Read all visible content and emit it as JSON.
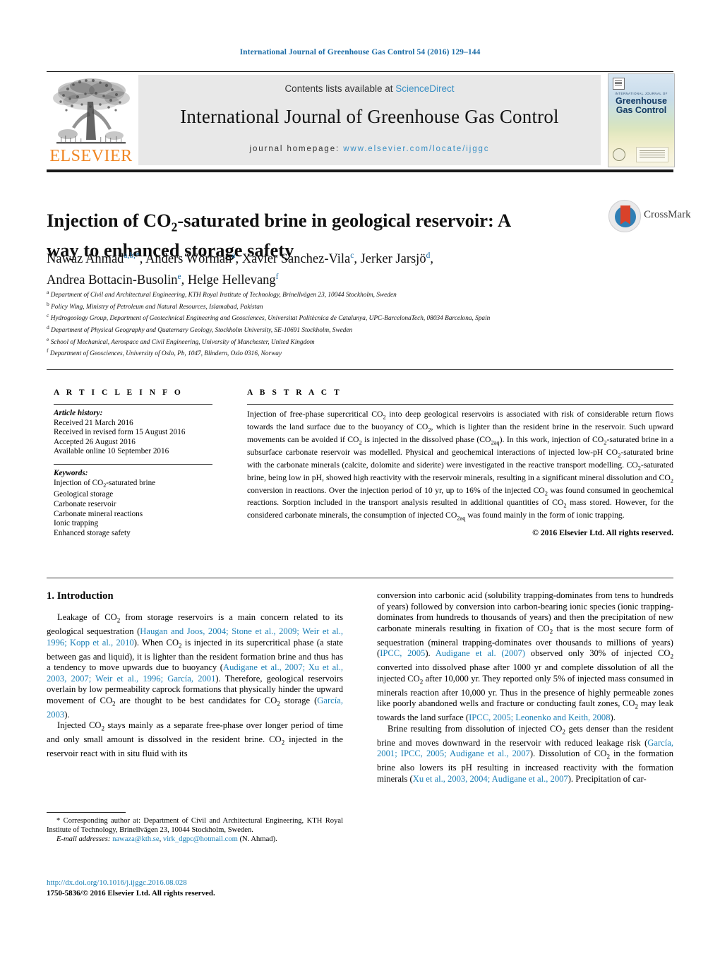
{
  "running_head": "International Journal of Greenhouse Gas Control 54 (2016) 129–144",
  "masthead": {
    "contents_prefix": "Contents lists available at ",
    "sciencedirect": "ScienceDirect",
    "journal_title": "International Journal of Greenhouse Gas Control",
    "homepage_label": "journal homepage:",
    "homepage_url": "www.elsevier.com/locate/ijggc",
    "publisher_logo_text": "ELSEVIER",
    "publisher_logo_color": "#f08522",
    "link_color": "#3a8fc4",
    "cover": {
      "kicker": "INTERNATIONAL JOURNAL OF",
      "name_line1": "Greenhouse",
      "name_line2": "Gas Control"
    }
  },
  "crossmark": {
    "label": "CrossMark"
  },
  "article": {
    "title_part1": "Injection of CO",
    "title_sub": "2",
    "title_part2": "-saturated brine in geological reservoir: A way to enhanced storage safety",
    "authors": [
      {
        "name": "Nawaz Ahmad",
        "marks": "a,b,*"
      },
      {
        "name": "Anders Wörman",
        "marks": "a"
      },
      {
        "name": "Xavier Sanchez-Vila",
        "marks": "c"
      },
      {
        "name": "Jerker Jarsjö",
        "marks": "d"
      },
      {
        "name": "Andrea Bottacin-Busolin",
        "marks": "e"
      },
      {
        "name": "Helge Hellevang",
        "marks": "f"
      }
    ],
    "affiliations": [
      {
        "mark": "a",
        "text": "Department of Civil and Architectural Engineering, KTH Royal Institute of Technology, Brinellvägen 23, 10044 Stockholm, Sweden"
      },
      {
        "mark": "b",
        "text": "Policy Wing, Ministry of Petroleum and Natural Resources, Islamabad, Pakistan"
      },
      {
        "mark": "c",
        "text": "Hydrogeology Group, Department of Geotechnical Engineering and Geosciences, Universitat Politècnica de Catalunya, UPC-BarcelonaTech, 08034 Barcelona, Spain"
      },
      {
        "mark": "d",
        "text": "Department of Physical Geography and Quaternary Geology, Stockholm University, SE-10691 Stockholm, Sweden"
      },
      {
        "mark": "e",
        "text": "School of Mechanical, Aerospace and Civil Engineering, University of Manchester, United Kingdom"
      },
      {
        "mark": "f",
        "text": "Department of Geosciences, University of Oslo, Pb, 1047, Blindern, Oslo 0316, Norway"
      }
    ]
  },
  "article_info": {
    "heading": "A R T I C L E   I N F O",
    "history_label": "Article history:",
    "history": [
      "Received 21 March 2016",
      "Received in revised form 15 August 2016",
      "Accepted 26 August 2016",
      "Available online 10 September 2016"
    ],
    "keywords_label": "Keywords:",
    "keywords": [
      "Injection of CO2-saturated brine",
      "Geological storage",
      "Carbonate reservoir",
      "Carbonate mineral reactions",
      "Ionic trapping",
      "Enhanced storage safety"
    ]
  },
  "abstract": {
    "heading": "A B S T R A C T",
    "text": "Injection of free-phase supercritical CO2 into deep geological reservoirs is associated with risk of considerable return flows towards the land surface due to the buoyancy of CO2, which is lighter than the resident brine in the reservoir. Such upward movements can be avoided if CO2 is injected in the dissolved phase (CO2aq). In this work, injection of CO2-saturated brine in a subsurface carbonate reservoir was modelled. Physical and geochemical interactions of injected low-pH CO2-saturated brine with the carbonate minerals (calcite, dolomite and siderite) were investigated in the reactive transport modelling. CO2-saturated brine, being low in pH, showed high reactivity with the reservoir minerals, resulting in a significant mineral dissolution and CO2 conversion in reactions. Over the injection period of 10 yr, up to 16% of the injected CO2 was found consumed in geochemical reactions. Sorption included in the transport analysis resulted in additional quantities of CO2 mass stored. However, for the considered carbonate minerals, the consumption of injected CO2aq was found mainly in the form of ionic trapping.",
    "copyright": "© 2016 Elsevier Ltd. All rights reserved."
  },
  "body": {
    "section_heading": "1. Introduction",
    "left_paragraphs": [
      "Leakage of CO2 from storage reservoirs is a main concern related to its geological sequestration (Haugan and Joos, 2004; Stone et al., 2009; Weir et al., 1996; Kopp et al., 2010). When CO2 is injected in its supercritical phase (a state between gas and liquid), it is lighter than the resident formation brine and thus has a tendency to move upwards due to buoyancy (Audigane et al., 2007; Xu et al., 2003, 2007; Weir et al., 1996; García, 2001). Therefore, geological reservoirs overlain by low permeability caprock formations that physically hinder the upward movement of CO2 are thought to be best candidates for CO2 storage (García, 2003).",
      "Injected CO2 stays mainly as a separate free-phase over longer period of time and only small amount is dissolved in the resident brine. CO2 injected in the reservoir react with in situ fluid with its"
    ],
    "right_paragraphs": [
      "conversion into carbonic acid (solubility trapping-dominates from tens to hundreds of years) followed by conversion into carbon-bearing ionic species (ionic trapping-dominates from hundreds to thousands of years) and then the precipitation of new carbonate minerals resulting in fixation of CO2 that is the most secure form of sequestration (mineral trapping-dominates over thousands to millions of years) (IPCC, 2005). Audigane et al. (2007) observed only 30% of injected CO2 converted into dissolved phase after 1000 yr and complete dissolution of all the injected CO2 after 10,000 yr. They reported only 5% of injected mass consumed in minerals reaction after 10,000 yr. Thus in the presence of highly permeable zones like poorly abandoned wells and fracture or conducting fault zones, CO2 may leak towards the land surface (IPCC, 2005; Leonenko and Keith, 2008).",
      "Brine resulting from dissolution of injected CO2 gets denser than the resident brine and moves downward in the reservoir with reduced leakage risk (García, 2001; IPCC, 2005; Audigane et al., 2007). Dissolution of CO2 in the formation brine also lowers its pH resulting in increased reactivity with the formation minerals (Xu et al., 2003, 2004; Audigane et al., 2007). Precipitation of car-"
    ]
  },
  "footnotes": {
    "corresponding_star": "*",
    "corresponding_text": "Corresponding author at: Department of Civil and Architectural Engineering, KTH Royal Institute of Technology, Brinellvägen 23, 10044 Stockholm, Sweden.",
    "email_label": "E-mail addresses:",
    "email1": "nawaza@kth.se",
    "email2": "virk_dgpc@hotmail.com",
    "email_suffix": "(N. Ahmad)."
  },
  "footer": {
    "doi": "http://dx.doi.org/10.1016/j.ijggc.2016.08.028",
    "issn_line": "1750-5836/© 2016 Elsevier Ltd. All rights reserved."
  }
}
